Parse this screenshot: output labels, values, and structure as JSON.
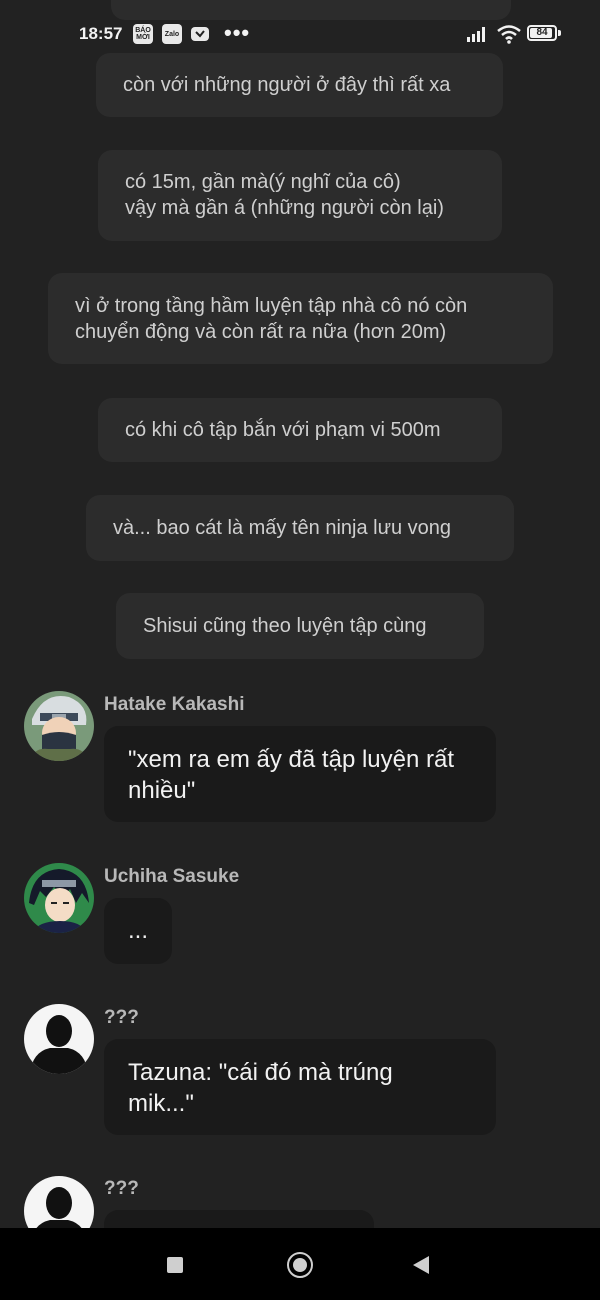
{
  "status_bar": {
    "time": "18:57",
    "app_icons": [
      "BÁO MỚI",
      "Zalo"
    ],
    "more_indicator": "•••",
    "battery_level": "84"
  },
  "messages": {
    "narration": [
      "còn với những người ở đây thì rất xa",
      "có 15m, gần mà(ý nghĩ của cô)\nvậy mà gần á (những người còn lại)",
      "vì ở trong tầng hầm luyện tập nhà cô nó còn\nchuyển động và còn rất ra nữa (hơn 20m)",
      "có khi cô tập bắn với phạm vi 500m",
      "và... bao cát là mấy tên ninja lưu vong",
      "Shisui cũng theo luyện tập cùng"
    ],
    "dialogue": [
      {
        "speaker": "Hatake Kakashi",
        "text": "\"xem ra em ấy đã tập luyện rất\nnhiều\""
      },
      {
        "speaker": "Uchiha Sasuke",
        "text": "..."
      },
      {
        "speaker": "???",
        "text": "Tazuna: \"cái đó mà trúng\nmik...\""
      },
      {
        "speaker": "???",
        "text": ""
      }
    ]
  },
  "colors": {
    "background": "#222222",
    "narration_bubble": "#2c2c2c",
    "dialogue_bubble": "#1a1a1a"
  }
}
